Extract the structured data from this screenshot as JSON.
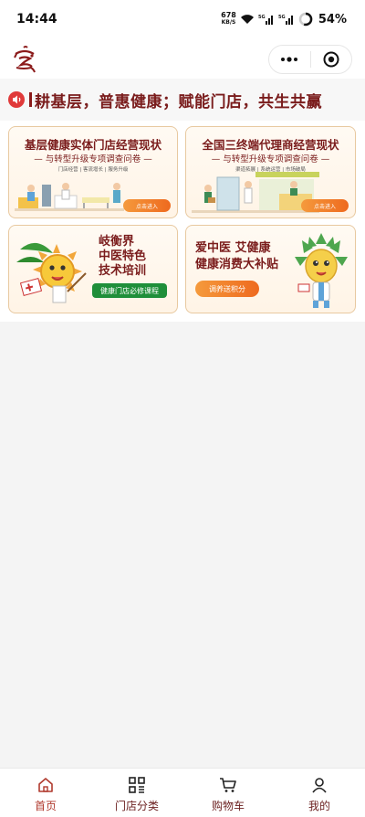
{
  "status_bar": {
    "time": "14:44",
    "net_speed_value": "678",
    "net_speed_unit": "KB/S",
    "battery": "54%"
  },
  "header": {
    "logo_icon": "brand-logo-icon",
    "more_icon": "more-dots-icon",
    "close_icon": "target-circle-icon"
  },
  "marquee": {
    "icon": "speaker-icon",
    "text": "耕基层，普惠健康；赋能门店，共生共赢"
  },
  "cards": [
    {
      "title": "基层健康实体门店经营现状",
      "subtitle": "— 与转型升级专项调查问卷 —",
      "tags": "门店经营 | 客流增长 | 服务升级",
      "button": "点击进入"
    },
    {
      "title": "全国三终端代理商经营现状",
      "subtitle": "— 与转型升级专项调查问卷 —",
      "tags": "渠道拓展 | 系统运营 | 市场破局",
      "button": "点击进入"
    },
    {
      "line1": "岐衡界",
      "line2": "中医特色",
      "line3": "技术培训",
      "pill": "健康门店必修课程"
    },
    {
      "line1": "爱中医 艾健康",
      "line2": "健康消费大补贴",
      "pill": "调养送积分"
    }
  ],
  "tabs": [
    {
      "label": "首页",
      "icon": "home-icon"
    },
    {
      "label": "门店分类",
      "icon": "category-grid-icon"
    },
    {
      "label": "购物车",
      "icon": "cart-icon"
    },
    {
      "label": "我的",
      "icon": "user-icon"
    }
  ],
  "colors": {
    "brand": "#7a1c1c",
    "accent_orange": "#ee6a1f",
    "green": "#1f8f3a",
    "marquee_icon": "#e03a3a"
  }
}
